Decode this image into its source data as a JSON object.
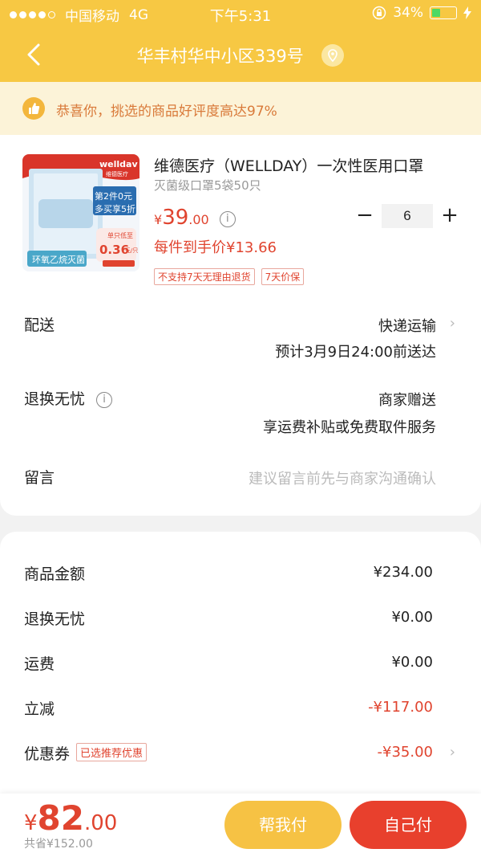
{
  "status": {
    "carrier": "中国移动",
    "network": "4G",
    "time": "下午5:31",
    "battery": "34%"
  },
  "header": {
    "address": "华丰村华中小区339号"
  },
  "notice": {
    "text": "恭喜你，挑选的商品好评度高达97%"
  },
  "product": {
    "image_brand": "welldav",
    "image_sub": "维德医疗",
    "image_promo1": "第2件0元",
    "image_promo2": "多买享5折",
    "image_price_label": "单只低至",
    "image_price": "0.36",
    "image_price_unit": "元/只",
    "image_bottom": "环氧乙烷灭菌",
    "title": "维德医疗（WELLDAY）一次性医用口罩",
    "spec": "灭菌级口罩5袋50只",
    "price_yen": "¥",
    "price_int": "39",
    "price_dec": ".00",
    "quantity": "6",
    "unit_price": "每件到手价¥13.66",
    "tags": [
      "不支持7天无理由退货",
      "7天价保"
    ]
  },
  "delivery": {
    "label": "配送",
    "method": "快递运输",
    "eta": "预计3月9日24:00前送达"
  },
  "returns": {
    "label": "退换无忧",
    "value": "商家赠送",
    "desc": "享运费补贴或免费取件服务"
  },
  "message": {
    "label": "留言",
    "placeholder": "建议留言前先与商家沟通确认"
  },
  "fees": {
    "goods_label": "商品金额",
    "goods_value": "¥234.00",
    "returns_label": "退换无忧",
    "returns_value": "¥0.00",
    "shipping_label": "运费",
    "shipping_value": "¥0.00",
    "discount_label": "立减",
    "discount_value": "-¥117.00",
    "coupon_label": "优惠券",
    "coupon_tag": "已选推荐优惠",
    "coupon_value": "-¥35.00"
  },
  "footer": {
    "total_yen": "¥",
    "total_int": "82",
    "total_dec": ".00",
    "saved": "共省¥152.00",
    "help_pay": "帮我付",
    "self_pay": "自己付"
  },
  "colors": {
    "brand_yellow": "#f7c843",
    "accent_red": "#e0442f"
  }
}
